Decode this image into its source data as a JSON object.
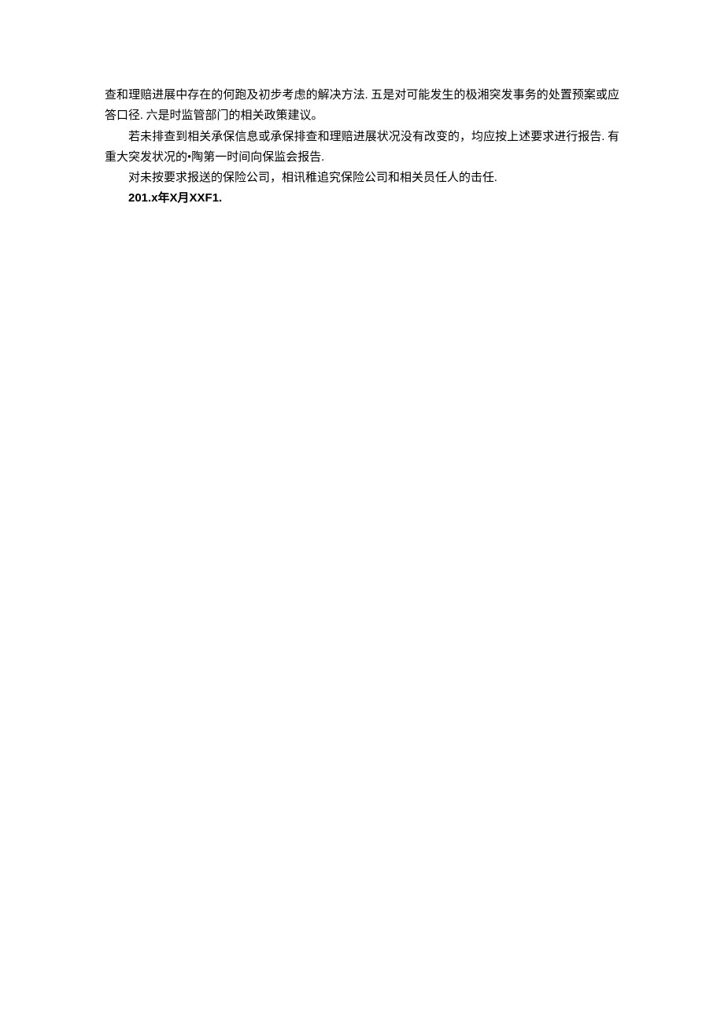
{
  "paragraphs": {
    "p1": "查和理赔进展中存在的何跑及初步考虑的解决方法. 五是对可能发生的极湘突发事务的处置预案或应答口径. 六是时监管部门的相关政策建议。",
    "p2": "若未排查到相关承保信息或承保排查和理赔进展状况没有改变的，均应按上述要求进行报告. 有重大突发状况的•陶第一时间向保监会报告.",
    "p3": "对未按要求报送的保险公司，相讯稚追究保险公司和相关员任人的击任.",
    "date": "201.x年X月XXF1."
  }
}
